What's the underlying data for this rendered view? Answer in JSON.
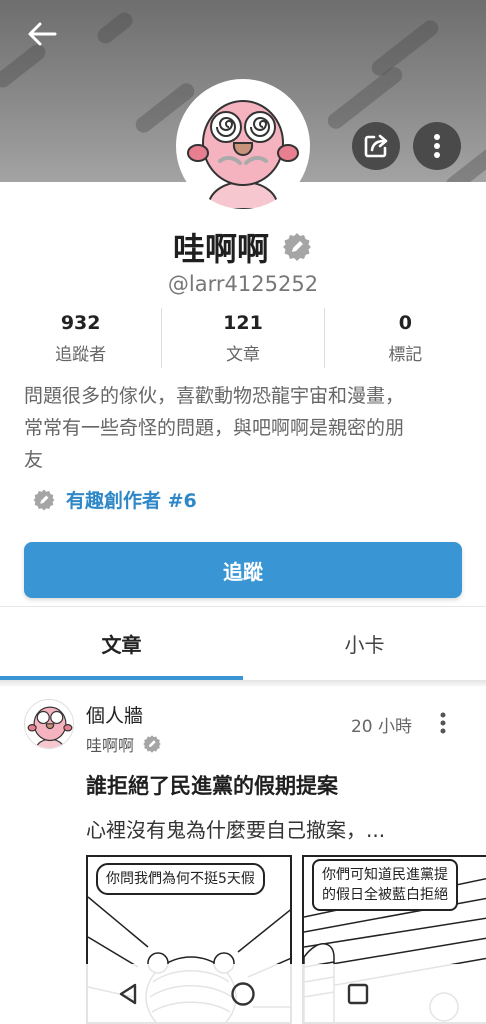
{
  "header": {
    "back_icon": "arrow-left-icon",
    "share_icon": "share-icon",
    "more_icon": "more-vertical-icon"
  },
  "profile": {
    "name": "哇啊啊",
    "handle": "@larr4125252",
    "verified_icon": "pen-badge-icon",
    "stats": [
      {
        "value": "932",
        "label": "追蹤者"
      },
      {
        "value": "121",
        "label": "文章"
      },
      {
        "value": "0",
        "label": "標記"
      }
    ],
    "bio_line1": "問題很多的傢伙，喜歡動物恐龍宇宙和漫畫，",
    "bio_line2": "常常有一些奇怪的問題，與吧啊啊是親密的朋",
    "bio_line3": "友",
    "creator_tag": "有趣創作者 #6",
    "follow_label": "追蹤"
  },
  "tabs": [
    {
      "label": "文章",
      "active": true
    },
    {
      "label": "小卡",
      "active": false
    }
  ],
  "post": {
    "board": "個人牆",
    "author": "哇啊啊",
    "time": "20 小時",
    "title": "誰拒絕了民進黨的假期提案",
    "excerpt": "心裡沒有鬼為什麼要自己撤案，...",
    "comic1_bubble": "你問我們為何不挺5天假",
    "comic2_bubble_line1": "你們可知道民進黨提",
    "comic2_bubble_line2": "的假日全被藍白拒絕"
  },
  "navbar": {
    "back_icon": "triangle-back-icon",
    "home_icon": "circle-home-icon",
    "recents_icon": "square-recents-icon"
  },
  "colors": {
    "accent": "#3a95d4",
    "link": "#2e88c7",
    "header_bg": "#7f7f7f"
  }
}
